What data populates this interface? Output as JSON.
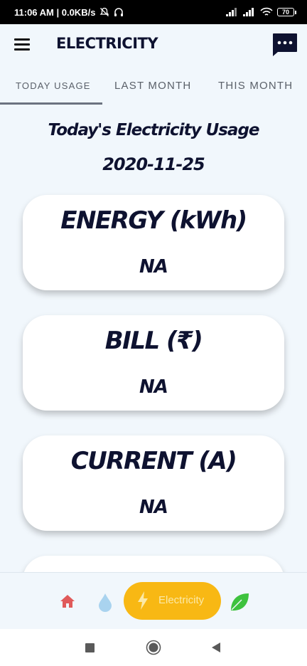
{
  "status_bar": {
    "left_text": "11:06 AM | 0.0KB/s",
    "battery": "70"
  },
  "app_bar": {
    "title": "ELECTRICITY",
    "menu_icon": "hamburger-menu-icon",
    "chat_icon": "chat-bubble-icon"
  },
  "tabs": [
    {
      "label": "TODAY USAGE",
      "active": true
    },
    {
      "label": "LAST MONTH",
      "active": false
    },
    {
      "label": "THIS MONTH",
      "active": false
    }
  ],
  "heading": {
    "title": "Today's Electricity Usage",
    "date": "2020-11-25"
  },
  "cards": [
    {
      "label": "ENERGY (kWh)",
      "value": "NA"
    },
    {
      "label": "BILL (₹)",
      "value": "NA"
    },
    {
      "label": "CURRENT (A)",
      "value": "NA"
    }
  ],
  "bottom_nav": {
    "items": [
      {
        "icon": "home-icon",
        "color": "#e05a5a"
      },
      {
        "icon": "water-drop-icon",
        "color": "#a9d3ef"
      },
      {
        "icon": "lightning-bolt-icon",
        "label": "Electricity",
        "active": true,
        "color": "#f8b814"
      },
      {
        "icon": "leaf-icon",
        "color": "#3ec23e"
      }
    ]
  },
  "system_nav": {
    "items": [
      "recent-apps-icon",
      "home-circle-icon",
      "back-triangle-icon"
    ]
  }
}
